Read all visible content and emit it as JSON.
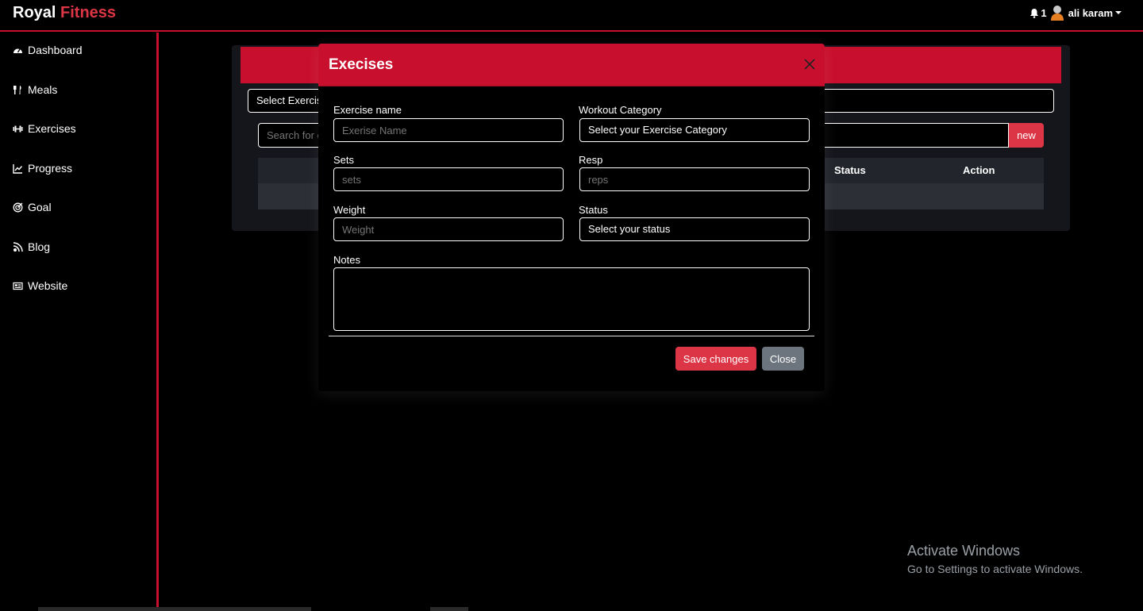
{
  "brand": {
    "part1": "Royal",
    "part2": "Fitness"
  },
  "user": {
    "notification_count": "1",
    "name": "ali karam"
  },
  "sidebar": {
    "items": [
      {
        "label": "Dashboard",
        "icon": "gauge-icon"
      },
      {
        "label": "Meals",
        "icon": "utensils-icon"
      },
      {
        "label": "Exercises",
        "icon": "dumbbell-icon"
      },
      {
        "label": "Progress",
        "icon": "chart-line-icon"
      },
      {
        "label": "Goal",
        "icon": "target-icon"
      },
      {
        "label": "Blog",
        "icon": "blog-icon"
      },
      {
        "label": "Website",
        "icon": "newspaper-icon"
      }
    ]
  },
  "panel": {
    "select_value": "Select Exercis",
    "search_placeholder": "Search for e",
    "new_label": "new",
    "columns": [
      "Status",
      "Action"
    ]
  },
  "modal": {
    "title": "Execises",
    "fields": {
      "exercise_name": {
        "label": "Exercise name",
        "placeholder": "Exerise Name"
      },
      "workout_category": {
        "label": "Workout Category",
        "value": "Select your Exercise Category"
      },
      "sets": {
        "label": "Sets",
        "placeholder": "sets"
      },
      "reps": {
        "label": "Resp",
        "placeholder": "reps"
      },
      "weight": {
        "label": "Weight",
        "placeholder": "Weight"
      },
      "status": {
        "label": "Status",
        "value": "Select your status"
      },
      "notes": {
        "label": "Notes"
      }
    },
    "save_label": "Save changes",
    "close_label": "Close"
  },
  "watermark": {
    "title": "Activate Windows",
    "subtitle": "Go to Settings to activate Windows."
  },
  "colors": {
    "accent": "#c8102e",
    "button_red": "#dc3545",
    "button_gray": "#6c757d"
  }
}
